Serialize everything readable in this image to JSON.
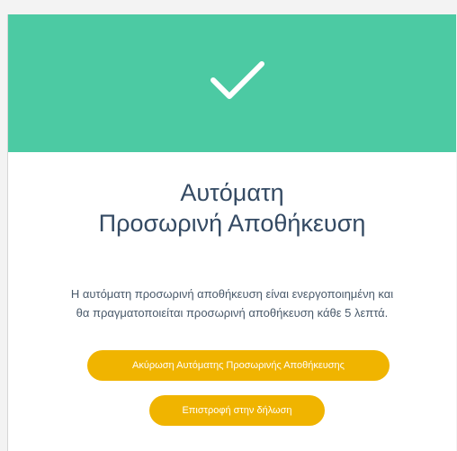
{
  "dialog": {
    "title_line1": "Αυτόματη",
    "title_line2": "Προσωρινή Αποθήκευση",
    "description_line1": "Η αυτόματη προσωρινή αποθήκευση είναι ενεργοποιημένη και",
    "description_line2": "θα πραγματοποιείται προσωρινή αποθήκευση κάθε 5 λεπτά.",
    "icon": "checkmark-icon"
  },
  "actions": {
    "cancel_autosave_label": "Ακύρωση Αυτόματης Προσωρινής Αποθήκευσης",
    "return_to_declaration_label": "Επιστροφή στην δήλωση"
  },
  "colors": {
    "banner": "#4ccaa3",
    "button": "#f0b400",
    "title_text": "#344a63"
  }
}
